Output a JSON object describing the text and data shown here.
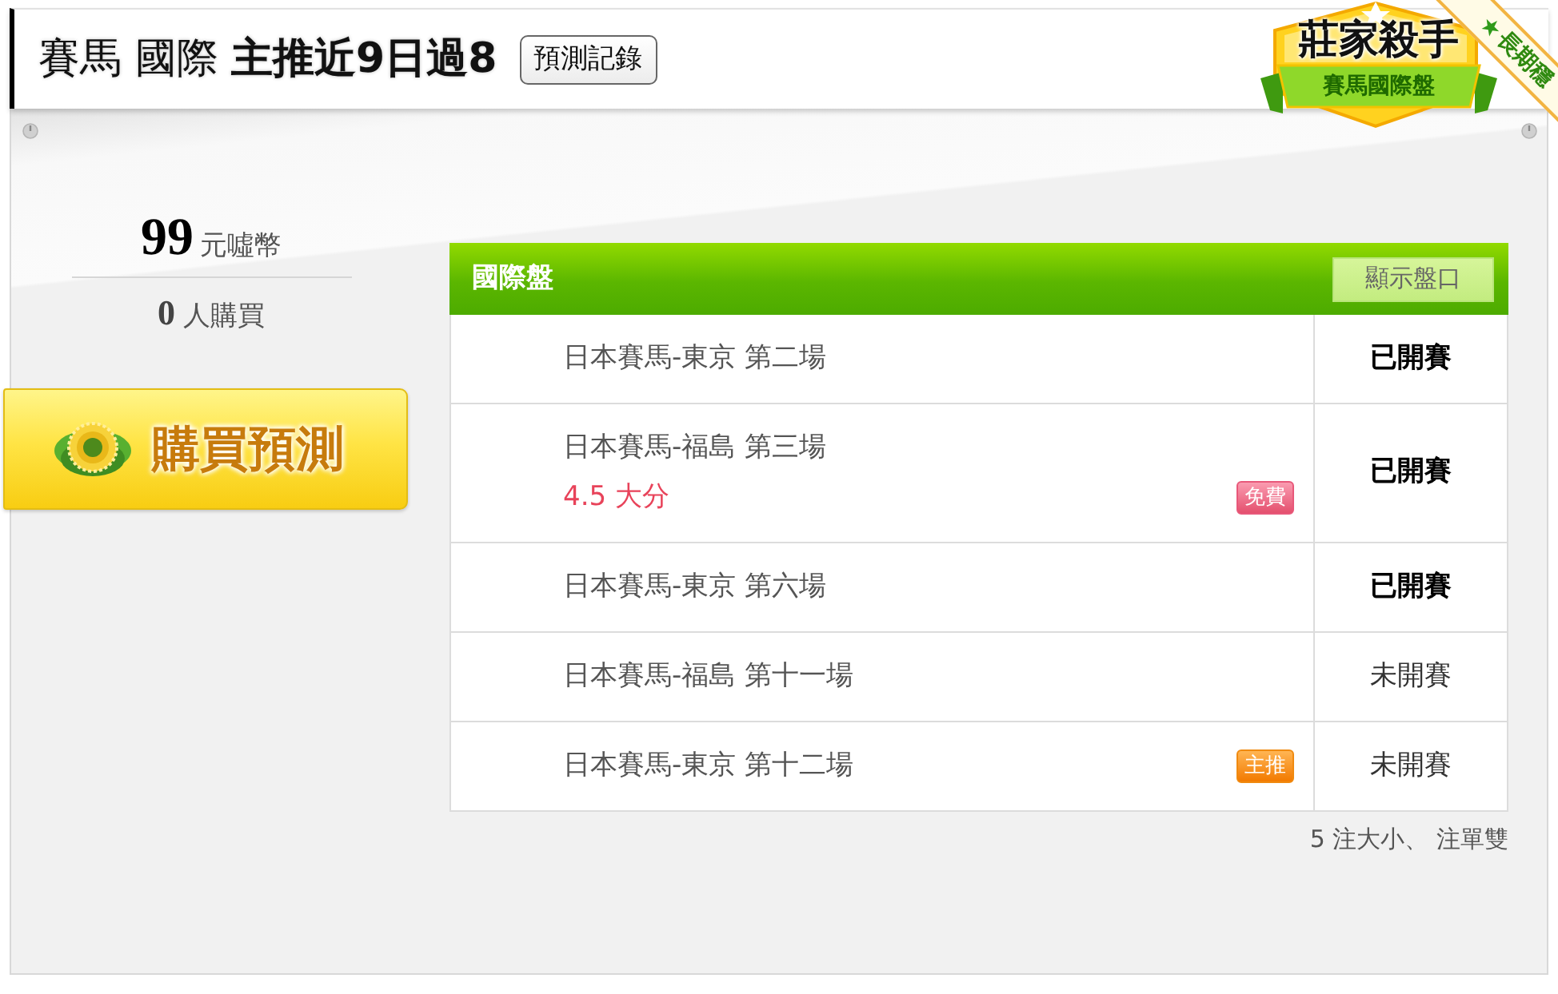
{
  "header": {
    "title": "賽馬 國際 **主推近9日過8**",
    "record_button": "預測記錄"
  },
  "badge": {
    "title": "莊家殺手",
    "subtitle": "賽馬國際盤",
    "ribbon": "長期穩"
  },
  "price": {
    "amount": "99",
    "unit": "元噓幣"
  },
  "buyers": {
    "count": "0",
    "unit": "人購買"
  },
  "buy_button": "購買預測",
  "table": {
    "title": "國際盤",
    "toggle_button": "顯示盤口",
    "rows": [
      {
        "race": "日本賽馬-東京 第二場",
        "status": "已開賽",
        "started": true
      },
      {
        "race": "日本賽馬-福島 第三場",
        "pick": "4.5 大分",
        "tag": {
          "kind": "free",
          "label": "免費"
        },
        "status": "已開賽",
        "started": true
      },
      {
        "race": "日本賽馬-東京 第六場",
        "status": "已開賽",
        "started": true
      },
      {
        "race": "日本賽馬-福島 第十一場",
        "status": "未開賽",
        "started": false
      },
      {
        "race": "日本賽馬-東京 第十二場",
        "tag": {
          "kind": "main",
          "label": "主推"
        },
        "status": "未開賽",
        "started": false
      }
    ]
  },
  "footer_note": "5 注大小、 注單雙"
}
